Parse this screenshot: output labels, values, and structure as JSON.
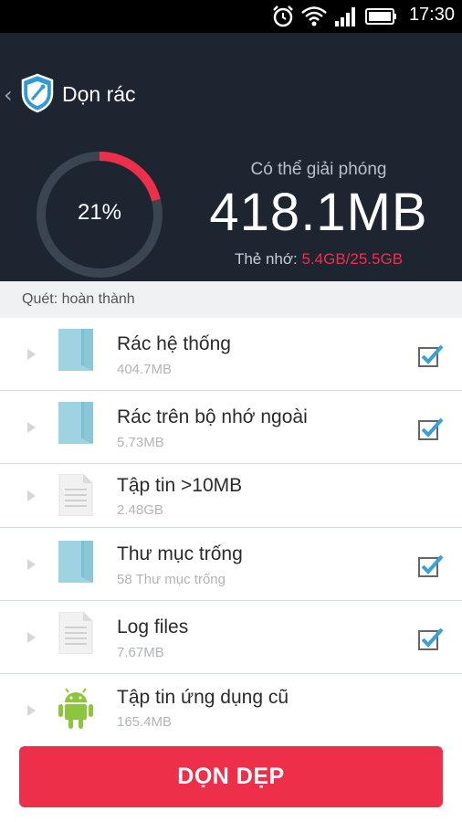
{
  "status_bar": {
    "time": "17:30",
    "icons": [
      "alarm-icon",
      "wifi-icon",
      "signal-icon",
      "battery-icon"
    ]
  },
  "header": {
    "title": "Dọn rác",
    "percent_label": "21%",
    "percent_value": 0.21,
    "free_caption": "Có thể giải phóng",
    "free_size": "418.1MB",
    "storage_label": "Thẻ nhớ: ",
    "storage_value": "5.4GB/25.5GB"
  },
  "scan_status": "Quét: hoàn thành",
  "items": [
    {
      "title": "Rác hệ thống",
      "subtitle": "404.7MB",
      "icon": "folder-icon",
      "checked": true
    },
    {
      "title": "Rác trên bộ nhớ ngoài",
      "subtitle": "5.73MB",
      "icon": "folder-icon",
      "checked": true
    },
    {
      "title": "Tập tin >10MB",
      "subtitle": "2.48GB",
      "icon": "document-icon",
      "checked": false
    },
    {
      "title": "Thư mục trống",
      "subtitle": "58 Thư mục trống",
      "icon": "folder-icon",
      "checked": true
    },
    {
      "title": "Log files",
      "subtitle": "7.67MB",
      "icon": "document-icon",
      "checked": true
    },
    {
      "title": "Tập tin ứng dụng cũ",
      "subtitle": "165.4MB",
      "icon": "android-icon",
      "checked": false
    }
  ],
  "clean_button": "DỌN DẸP",
  "colors": {
    "accent": "#ed2f4a",
    "header_bg": "#1d2531",
    "check": "#3aa0d8",
    "folder": "#9fd3e2"
  }
}
